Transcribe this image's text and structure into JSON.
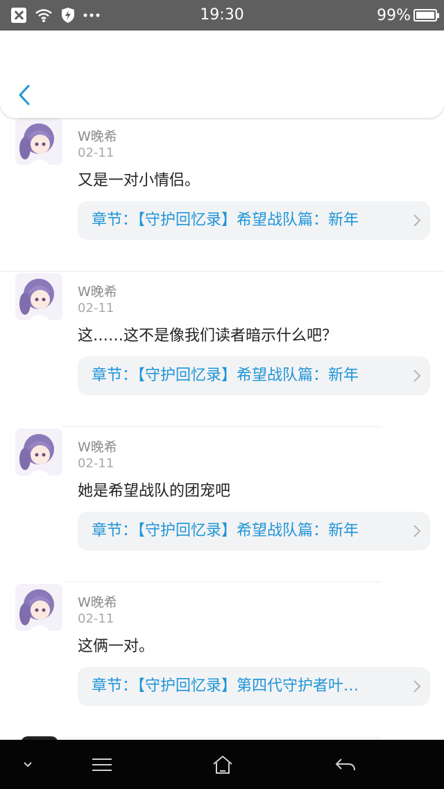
{
  "status_bar": {
    "time": "19:30",
    "battery_percent": "99%",
    "battery_level": 0.99,
    "icons": [
      "notification-x-icon",
      "wifi-icon",
      "shield-icon",
      "more-dots-icon",
      "battery-icon"
    ]
  },
  "header": {
    "back_icon": "chevron-left-icon",
    "accent_color": "#1f95d8"
  },
  "comments": [
    {
      "user": "W晚希",
      "date": "02-11",
      "text": "又是一对小情侣。",
      "chapter": "章节：【守护回忆录】希望战队篇：新年"
    },
    {
      "user": "W晚希",
      "date": "02-11",
      "text": "这……这不是像我们读者暗示什么吧？",
      "chapter": "章节：【守护回忆录】希望战队篇：新年"
    },
    {
      "user": "W晚希",
      "date": "02-11",
      "text": "她是希望战队的团宠吧",
      "chapter": "章节：【守护回忆录】希望战队篇：新年"
    },
    {
      "user": "W晚希",
      "date": "02-11",
      "text": "这俩一对。",
      "chapter": "章节：【守护回忆录】第四代守护者叶…"
    }
  ],
  "nav_bar": {
    "icons": [
      "collapse-chevron-icon",
      "menu-icon",
      "home-icon",
      "back-arrow-icon"
    ]
  }
}
